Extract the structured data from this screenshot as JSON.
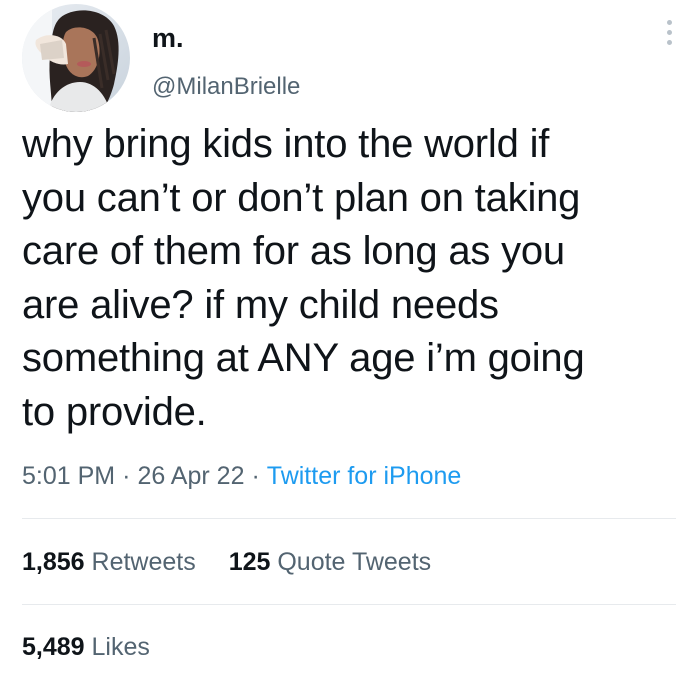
{
  "user": {
    "display_name": "m.",
    "handle": "@MilanBrielle",
    "avatar_icon": "profile-photo"
  },
  "tweet": {
    "text": "why bring kids into the world if\nyou can’t or don’t plan on taking\ncare of them for as long as you\nare alive? if my child needs\nsomething at ANY age i’m going\nto provide.",
    "time": "5:01 PM",
    "date": "26 Apr 22",
    "separator": "·",
    "source": "Twitter for iPhone"
  },
  "stats": {
    "retweets_count": "1,856",
    "retweets_label": "Retweets",
    "quote_count": "125",
    "quote_label": "Quote Tweets",
    "likes_count": "5,489",
    "likes_label": "Likes"
  },
  "colors": {
    "text": "#0f1419",
    "secondary": "#536471",
    "accent": "#1d9bf0",
    "divider": "#e7eaed"
  }
}
